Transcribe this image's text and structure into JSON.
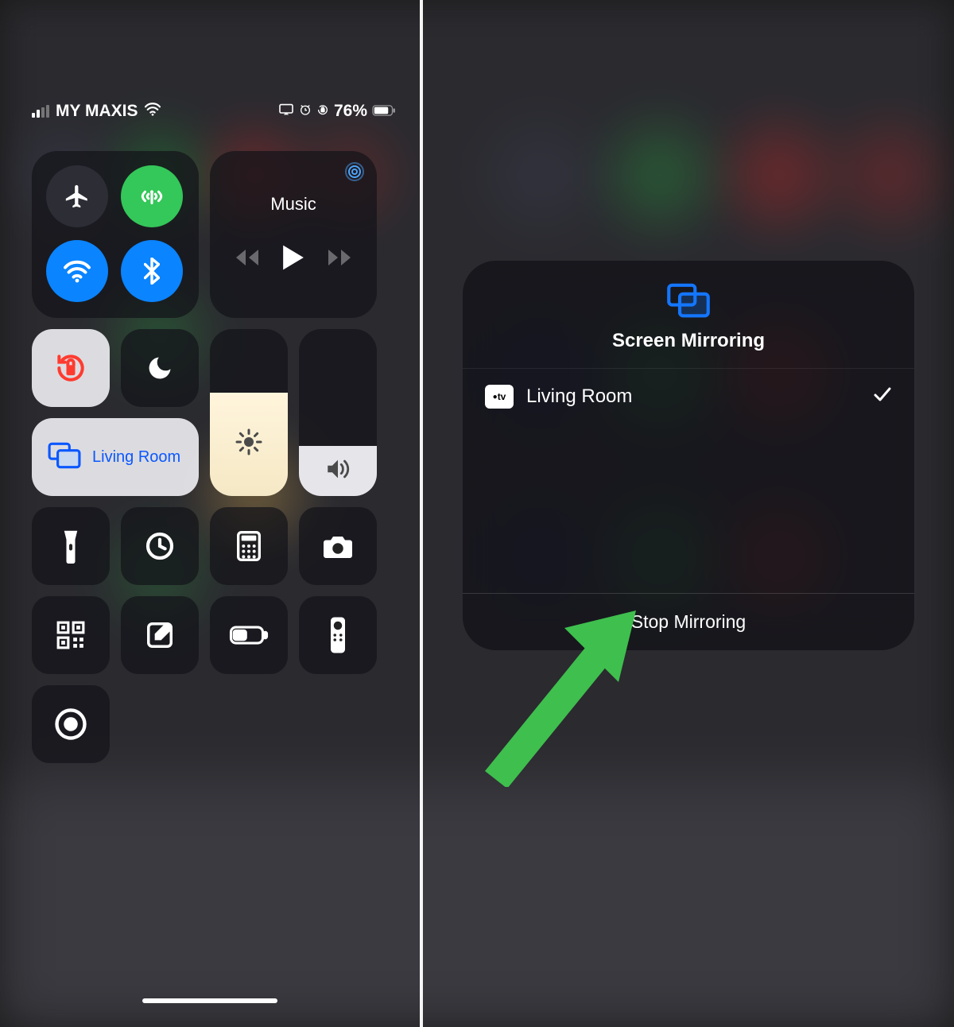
{
  "status_bar": {
    "carrier": "MY MAXIS",
    "battery_percent": "76%"
  },
  "control_center": {
    "music_label": "Music",
    "screen_mirror_target": "Living Room",
    "brightness_level": 0.62,
    "volume_level": 0.3,
    "toggles": {
      "airplane_mode": false,
      "cellular_data": true,
      "wifi": true,
      "bluetooth": true,
      "orientation_lock": true,
      "do_not_disturb": false
    },
    "utility_buttons": [
      "flashlight",
      "timer",
      "calculator",
      "camera",
      "qr-scanner",
      "notes",
      "low-power-mode",
      "apple-tv-remote",
      "screen-record"
    ]
  },
  "mirroring_popup": {
    "title": "Screen Mirroring",
    "devices": [
      {
        "name": "Living Room",
        "type": "apple-tv",
        "selected": true
      }
    ],
    "stop_label": "Stop Mirroring",
    "atv_badge_text": "tv"
  },
  "annotation": {
    "arrow_color": "#3fbf4e"
  }
}
